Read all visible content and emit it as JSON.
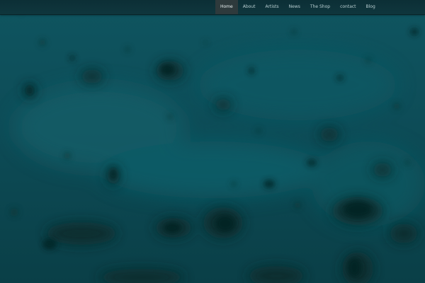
{
  "nav": {
    "items": [
      {
        "label": "Home",
        "active": true
      },
      {
        "label": "About",
        "active": false
      },
      {
        "label": "Artists",
        "active": false
      },
      {
        "label": "News",
        "active": false
      },
      {
        "label": "The Shop",
        "active": false
      },
      {
        "label": "contact",
        "active": false
      },
      {
        "label": "Blog",
        "active": false
      }
    ]
  },
  "colors": {
    "background": "#0d4a55",
    "navbar": "#0c2f36",
    "nav_active": "#2e3a3c",
    "nav_text": "#b9cfd2"
  }
}
